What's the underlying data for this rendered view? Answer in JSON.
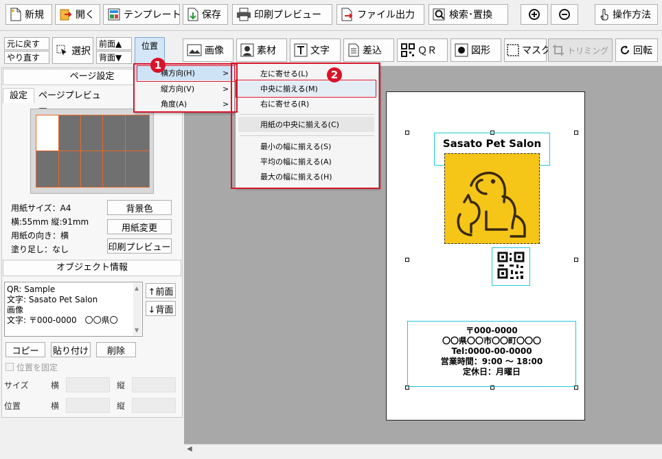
{
  "toolbar1": {
    "new": "新規",
    "open": "開く",
    "template": "テンプレート",
    "save": "保存",
    "print_preview": "印刷プレビュー",
    "file_output": "ファイル出力",
    "search_replace": "検索･置換",
    "help": "操作方法"
  },
  "toolbar2": {
    "undo": "元に戻す",
    "redo": "やり直す",
    "select": "選択",
    "front": "前面▲",
    "back": "背面▼",
    "position": "位置",
    "image": "画像",
    "material": "素材",
    "text": "文字",
    "insert": "差込",
    "qr": "ＱＲ",
    "shape": "図形",
    "mask": "マスク",
    "trimming": "トリミング",
    "rotate": "回転"
  },
  "page_settings": {
    "title": "ページ設定",
    "tab_settings": "設定",
    "tab_preview": "ページプレビュー",
    "paper_size": "用紙サイズ：A4",
    "dimensions": "横:55mm 縦:91mm",
    "orientation": "用紙の向き：横",
    "bleed": "塗り足し：なし",
    "btn_background": "背景色",
    "btn_change_paper": "用紙変更",
    "btn_print_preview": "印刷プレビュー"
  },
  "object_info": {
    "title": "オブジェクト情報",
    "items": [
      "QR: Sample",
      "文字: Sasato Pet Salon",
      "画像",
      "文字: 〒000-0000　〇〇県〇"
    ],
    "btn_front": "↑前面",
    "btn_back": "↓背面",
    "btn_copy": "コピー",
    "btn_paste": "貼り付け",
    "btn_delete": "削除",
    "lock_position": "位置を固定",
    "size_label": "サイズ",
    "pos_label": "位置",
    "horizontal": "横",
    "vertical": "縦"
  },
  "menu_primary": {
    "horizontal": "横方向(H)",
    "vertical": "縦方向(V)",
    "angle": "角度(A)",
    "arrow": ">"
  },
  "menu_sub": {
    "align_left": "左に寄せる(L)",
    "align_center": "中央に揃える(M)",
    "align_right": "右に寄せる(R)",
    "paper_center": "用紙の中央に揃える(C)",
    "min_width": "最小の幅に揃える(S)",
    "avg_width": "平均の幅に揃える(A)",
    "max_width": "最大の幅に揃える(H)"
  },
  "badges": {
    "one": "1",
    "two": "2"
  },
  "card": {
    "title": "Sasato Pet Salon",
    "address_lines": [
      "〒000-0000",
      "〇〇県〇〇市〇〇町〇〇〇",
      "Tel:0000-00-0000",
      "営業時間：9:00 〜 18:00",
      "定休日：月曜日"
    ],
    "image_bg": "#f5c518"
  },
  "colors": {
    "accent_red": "#d7142a",
    "selection_cyan": "#22c7d6",
    "grid_orange": "#e86b2a"
  }
}
